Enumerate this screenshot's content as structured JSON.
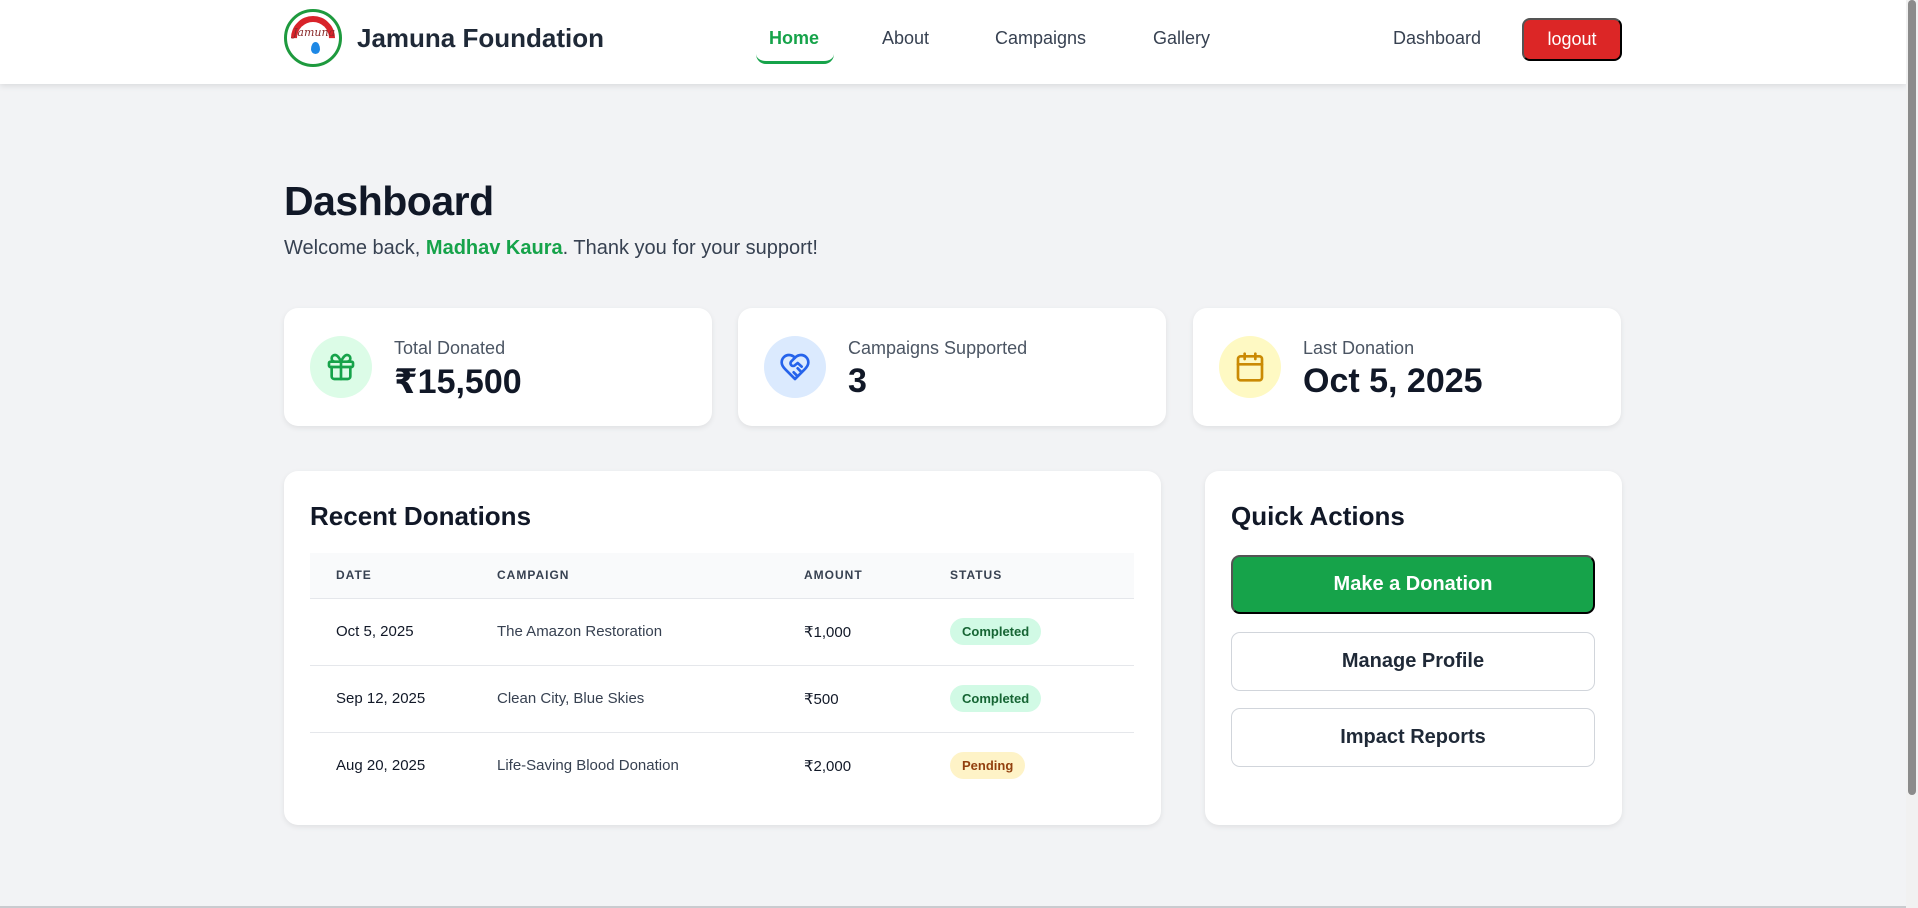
{
  "nav": {
    "brand": "Jamuna Foundation",
    "links": [
      "Home",
      "About",
      "Campaigns",
      "Gallery"
    ],
    "dashboard": "Dashboard",
    "logout": "logout"
  },
  "header": {
    "title": "Dashboard",
    "welcome_prefix": "Welcome back, ",
    "user_name": "Madhav Kaura",
    "welcome_suffix": ". Thank you for your support!"
  },
  "stats": [
    {
      "label": "Total Donated",
      "value": "₹15,500",
      "icon": "gift-icon",
      "color": "#16a34a",
      "bg": "#dcfce7"
    },
    {
      "label": "Campaigns Supported",
      "value": "3",
      "icon": "heart-handshake-icon",
      "color": "#2563eb",
      "bg": "#dbeafe"
    },
    {
      "label": "Last Donation",
      "value": "Oct 5, 2025",
      "icon": "calendar-icon",
      "color": "#ca8a04",
      "bg": "#fef9c3"
    }
  ],
  "donations": {
    "title": "Recent Donations",
    "columns": [
      "DATE",
      "CAMPAIGN",
      "AMOUNT",
      "STATUS"
    ],
    "rows": [
      {
        "date": "Oct 5, 2025",
        "campaign": "The Amazon Restoration",
        "amount": "₹1,000",
        "status": "Completed"
      },
      {
        "date": "Sep 12, 2025",
        "campaign": "Clean City, Blue Skies",
        "amount": "₹500",
        "status": "Completed"
      },
      {
        "date": "Aug 20, 2025",
        "campaign": "Life-Saving Blood Donation",
        "amount": "₹2,000",
        "status": "Pending"
      }
    ]
  },
  "quick_actions": {
    "title": "Quick Actions",
    "buttons": [
      "Make a Donation",
      "Manage Profile",
      "Impact Reports"
    ]
  },
  "colors": {
    "accent": "#16a34a",
    "danger": "#dc2626",
    "background": "#f2f3f5"
  }
}
